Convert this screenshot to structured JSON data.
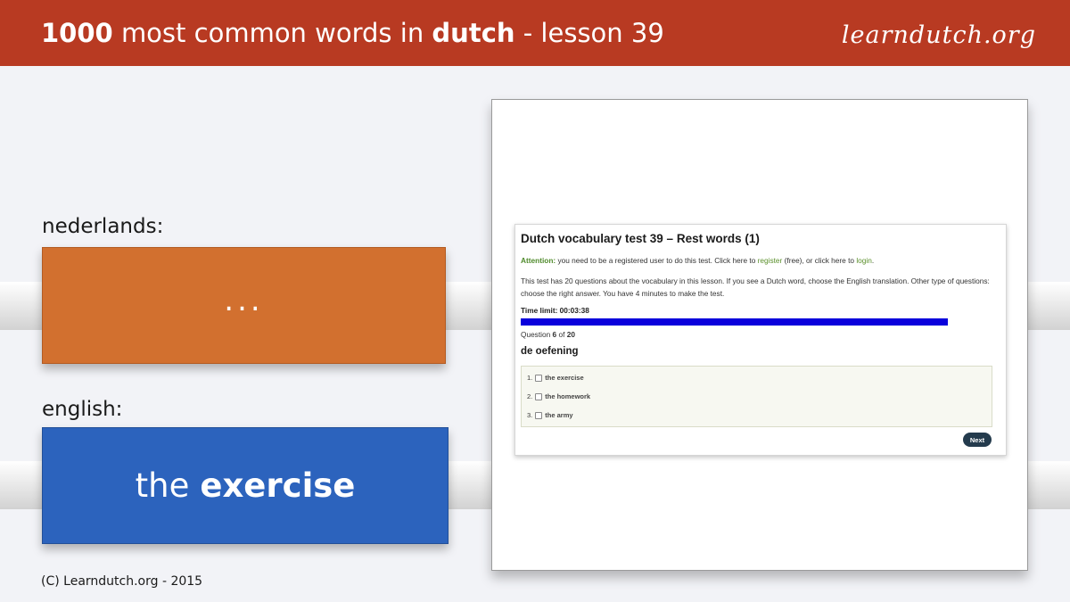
{
  "header": {
    "title_count": "1000",
    "title_middle": "most common words in",
    "title_lang": "dutch",
    "title_lesson": "- lesson 39",
    "brand": "learndutch.org"
  },
  "left": {
    "dutch_label": "nederlands:",
    "dutch_value": "...",
    "english_label": "english:",
    "english_article": "the",
    "english_word": "exercise"
  },
  "footer": {
    "copyright": "(C) Learndutch.org - 2015"
  },
  "quiz": {
    "title": "Dutch vocabulary test 39 – Rest words (1)",
    "attention_label": "Attention:",
    "attention_text_1": "you need to be a registered user to do this test. Click here to",
    "register_link": "register",
    "attention_text_2": "(free), or click here to",
    "login_link": "login",
    "attention_text_3": ".",
    "info": "This test has 20 questions about the vocabulary in this lesson. If you see a Dutch word, choose the English translation. Other type of questions: choose the right answer. You have 4 minutes to make the test.",
    "time_limit": "Time limit: 00:03:38",
    "progress_fraction": 1.0,
    "question_prefix": "Question",
    "question_current": "6",
    "question_of": "of",
    "question_total": "20",
    "question_word": "de oefening",
    "answers": [
      {
        "num": "1.",
        "text": "the exercise"
      },
      {
        "num": "2.",
        "text": "the homework"
      },
      {
        "num": "3.",
        "text": "the army"
      }
    ],
    "next_label": "Next"
  },
  "colors": {
    "banner": "#b83a22",
    "dutch_card": "#d2702f",
    "english_card": "#2c63bd",
    "progress": "#0a00dc",
    "next_button": "#243b4d"
  }
}
